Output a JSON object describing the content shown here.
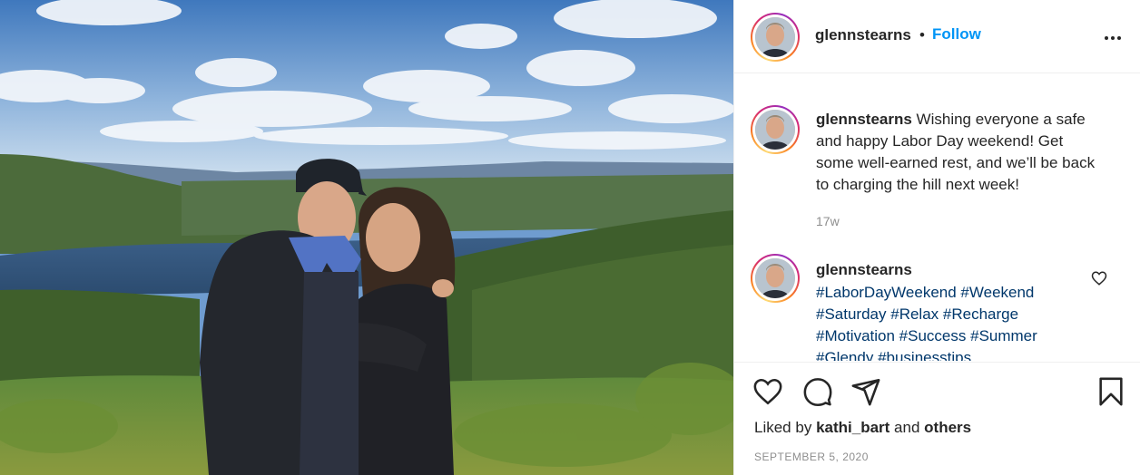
{
  "post": {
    "username": "glennstearns",
    "separator": "•",
    "follow_label": "Follow",
    "more_icon": "more-options-icon"
  },
  "caption": {
    "username": "glennstearns",
    "text": "Wishing everyone a safe and happy Labor Day weekend! Get some well-earned rest, and we’ll be back to charging the hill next week!",
    "time": "17w"
  },
  "comment": {
    "username": "glennstearns",
    "hashtags": [
      "#LaborDayWeekend",
      "#Weekend",
      "#Saturday",
      "#Relax",
      "#Recharge",
      "#Motivation",
      "#Success",
      "#Summer",
      "#Glendy",
      "#businesstips"
    ]
  },
  "actions": {
    "like_icon": "heart-icon",
    "comment_icon": "comment-icon",
    "share_icon": "share-icon",
    "save_icon": "bookmark-icon",
    "liked_by_prefix": "Liked by",
    "liked_by_user": "kathi_bart",
    "liked_by_and": "and",
    "liked_by_others": "others",
    "date": "SEPTEMBER 5, 2020"
  },
  "colors": {
    "link_blue": "#0095f6",
    "hashtag_blue": "#00376b",
    "muted": "#8e8e8e",
    "text": "#262626"
  }
}
